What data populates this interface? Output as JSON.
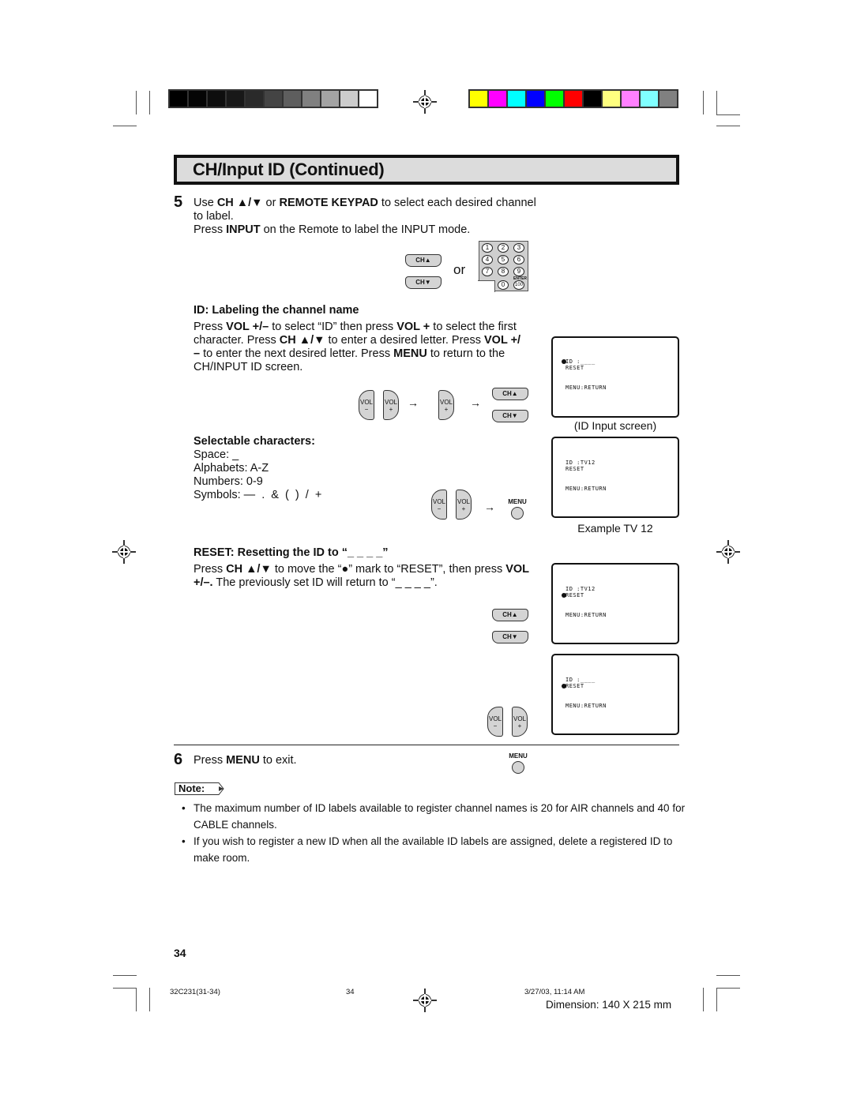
{
  "color_bars": {
    "grays": [
      "#000000",
      "#050505",
      "#0e0e0e",
      "#181818",
      "#2a2a2a",
      "#444444",
      "#5e5e5e",
      "#808080",
      "#a3a3a3",
      "#cccccc",
      "#ffffff"
    ],
    "colors": [
      "#ffff00",
      "#ff00ff",
      "#00ffff",
      "#0000ff",
      "#00ff00",
      "#ff0000",
      "#000000",
      "#ffff80",
      "#ff80ff",
      "#80ffff",
      "#808080"
    ]
  },
  "header": {
    "title": "CH/Input ID (Continued)"
  },
  "step5": {
    "number": "5",
    "line1_pre": "Use ",
    "line1_b1": "CH ▲/▼",
    "line1_mid": " or ",
    "line1_b2": "REMOTE KEYPAD",
    "line1_post": " to select each desired channel",
    "line2": "to label.",
    "line3_pre": "Press ",
    "line3_b": "INPUT",
    "line3_post": " on the Remote to label the INPUT mode.",
    "or_label": "or"
  },
  "buttons": {
    "ch_up": "CH▲",
    "ch_down": "CH▼",
    "vol": "VOL",
    "vol_minus": "−",
    "vol_plus": "+",
    "menu": "MENU",
    "arrow": "→"
  },
  "keypad": {
    "keys": [
      "1",
      "2",
      "3",
      "4",
      "5",
      "6",
      "7",
      "8",
      "9",
      "0",
      "100"
    ],
    "enter_label": "ENTER"
  },
  "id_labeling": {
    "heading": "ID: Labeling the channel name",
    "l1_a": "Press ",
    "l1_b": "VOL +/–",
    "l1_c": " to select “ID” then press  ",
    "l1_d": "VOL +",
    "l1_e": " to select the first",
    "l2_a": "character. Press ",
    "l2_b": "CH ▲/▼",
    "l2_c": " to enter a desired letter. Press ",
    "l2_d": "VOL +/",
    "l3_a": "–",
    "l3_b": " to enter the next desired letter. Press ",
    "l3_c": "MENU",
    "l3_d": " to return to the",
    "l4": "CH/INPUT ID screen."
  },
  "selectable": {
    "heading": "Selectable characters:",
    "items": [
      "Space: _",
      "Alphabets: A-Z",
      "Numbers: 0-9",
      "Symbols: —  .  &  (  )  /  +"
    ]
  },
  "reset": {
    "heading": "RESET: Resetting the ID to “_ _ _ _”",
    "l1_a": "Press ",
    "l1_b": "CH ▲/▼",
    "l1_c": " to move the “●” mark to “RESET”, then press ",
    "l1_d": "VOL",
    "l2_a": "+/–.",
    "l2_b": " The previously set ID will return to “_ _ _ _”."
  },
  "tv_screens": [
    {
      "id_line": "ID :____",
      "reset_line": "RESET",
      "menu_line": "MENU:RETURN",
      "cursor": "id",
      "caption": "(ID Input screen)"
    },
    {
      "id_line": "ID :TV12",
      "reset_line": "RESET",
      "menu_line": "MENU:RETURN",
      "cursor": "none",
      "caption": "Example TV 12"
    },
    {
      "id_line": "ID :TV12",
      "reset_line": "RESET",
      "menu_line": "MENU:RETURN",
      "cursor": "reset",
      "caption": ""
    },
    {
      "id_line": "ID :____",
      "reset_line": "RESET",
      "menu_line": "MENU:RETURN",
      "cursor": "reset",
      "caption": ""
    }
  ],
  "step6": {
    "number": "6",
    "pre": "Press ",
    "b": "MENU",
    "post": " to exit."
  },
  "note": {
    "label": "Note:",
    "bullets": [
      "The maximum number of ID labels available to register channel names is 20 for AIR channels and 40 for CABLE channels.",
      "If you wish to register a new ID when all the available ID labels are assigned, delete a registered ID to make room."
    ],
    "bullet_char": "•"
  },
  "footer": {
    "page_number": "34",
    "file_code": "32C231(31-34)",
    "slug_page": "34",
    "timestamp": "3/27/03, 11:14 AM",
    "dimension": "Dimension: 140  X 215 mm"
  }
}
